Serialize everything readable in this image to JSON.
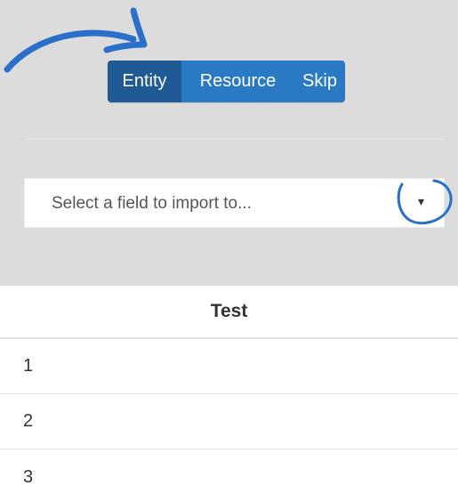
{
  "import_panel": {
    "buttons": [
      {
        "label": "Entity",
        "active": true
      },
      {
        "label": "Resource",
        "active": false
      },
      {
        "label": "Skip",
        "active": false
      }
    ],
    "select": {
      "placeholder": "Select a field to import to...",
      "caret_icon": "▾"
    }
  },
  "annotations": {
    "arrow_icon": "curved-arrow-icon",
    "circle_icon": "highlight-circle-icon",
    "color": "#2a6fc9"
  },
  "table": {
    "header": "Test",
    "rows": [
      "1",
      "2",
      "3"
    ]
  },
  "colors": {
    "button_active": "#1f5a94",
    "button": "#2a79c4",
    "panel_bg": "#dcdcdc"
  }
}
